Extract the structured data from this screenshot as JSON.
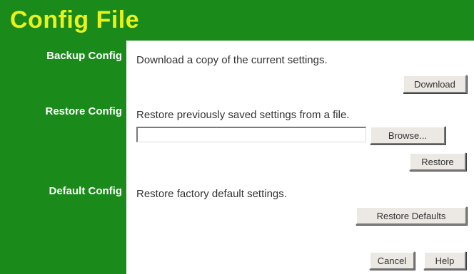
{
  "page": {
    "title": "Config File"
  },
  "sections": {
    "backup": {
      "label": "Backup Config",
      "description": "Download a copy of the current settings.",
      "button_label": "Download"
    },
    "restore": {
      "label": "Restore Config",
      "description": "Restore previously saved settings from a file.",
      "file_value": "",
      "browse_label": "Browse...",
      "button_label": "Restore"
    },
    "defaults": {
      "label": "Default Config",
      "description": "Restore factory default settings.",
      "button_label": "Restore Defaults"
    }
  },
  "footer": {
    "cancel_label": "Cancel",
    "help_label": "Help"
  },
  "colors": {
    "band": "#1a8a1a",
    "title": "#e9f21a",
    "label": "#ffffff",
    "background": "#ffffff"
  }
}
